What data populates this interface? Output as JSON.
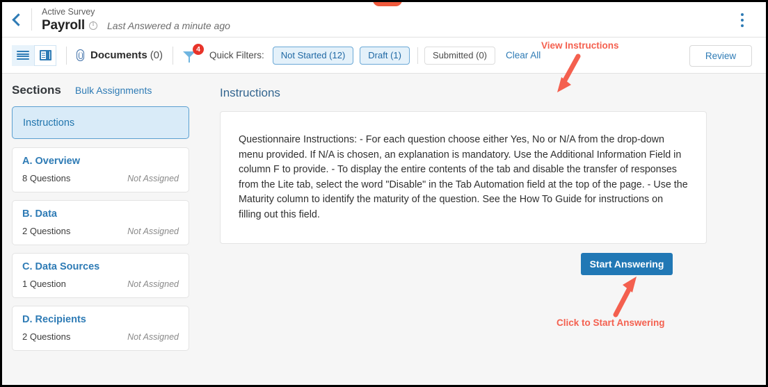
{
  "header": {
    "back_icon": "chevron-left-icon",
    "eyebrow": "Active Survey",
    "title": "Payroll",
    "info_icon": "info-circle-icon",
    "last_answered": "Last Answered a minute ago",
    "menu_icon": "kebab-menu-icon"
  },
  "toolbar": {
    "list_view_icon": "list-view-icon",
    "card_view_icon": "card-view-icon",
    "attachment_icon": "paperclip-icon",
    "documents_label": "Documents",
    "documents_count": "(0)",
    "filter_icon": "funnel-filter-icon",
    "filter_badge": "4",
    "quick_filters_label": "Quick Filters:",
    "chips": [
      {
        "label": "Not Started (12)",
        "active": true
      },
      {
        "label": "Draft (1)",
        "active": true
      },
      {
        "label": "Submitted (0)",
        "active": false
      }
    ],
    "clear_all": "Clear All",
    "review_label": "Review"
  },
  "sidebar": {
    "title": "Sections",
    "bulk_assignments": "Bulk Assignments",
    "selected_item": "Instructions",
    "sections": [
      {
        "name": "A. Overview",
        "questions": "8 Questions",
        "assignment": "Not Assigned"
      },
      {
        "name": "B. Data",
        "questions": "2 Questions",
        "assignment": "Not Assigned"
      },
      {
        "name": "C. Data Sources",
        "questions": "1 Question",
        "assignment": "Not Assigned"
      },
      {
        "name": "D. Recipients",
        "questions": "2 Questions",
        "assignment": "Not Assigned"
      }
    ]
  },
  "main": {
    "panel_title": "Instructions",
    "instructions_text": "Questionnaire Instructions: - For each question choose either Yes, No or N/A from the drop-down menu provided. If N/A is chosen, an explanation is mandatory. Use the Additional Information Field in column F to provide. - To display the entire contents of the tab and disable the transfer of responses from the Lite tab, select the word \"Disable\" in the Tab Automation field at the top of the page. - Use the Maturity column to identify the maturity of the question. See the How To Guide for instructions on filling out this field.",
    "start_button": "Start Answering"
  },
  "annotations": [
    {
      "text": "View Instructions",
      "arrow": "down-left-arrow"
    },
    {
      "text": "Click to Start Answering",
      "arrow": "up-right-arrow"
    }
  ],
  "colors": {
    "accent_blue": "#2e7bb5",
    "button_blue": "#2178b5",
    "annotation_red": "#f4604f",
    "badge_red": "#e8342a",
    "selected_blue_bg": "#d9ebf8"
  }
}
